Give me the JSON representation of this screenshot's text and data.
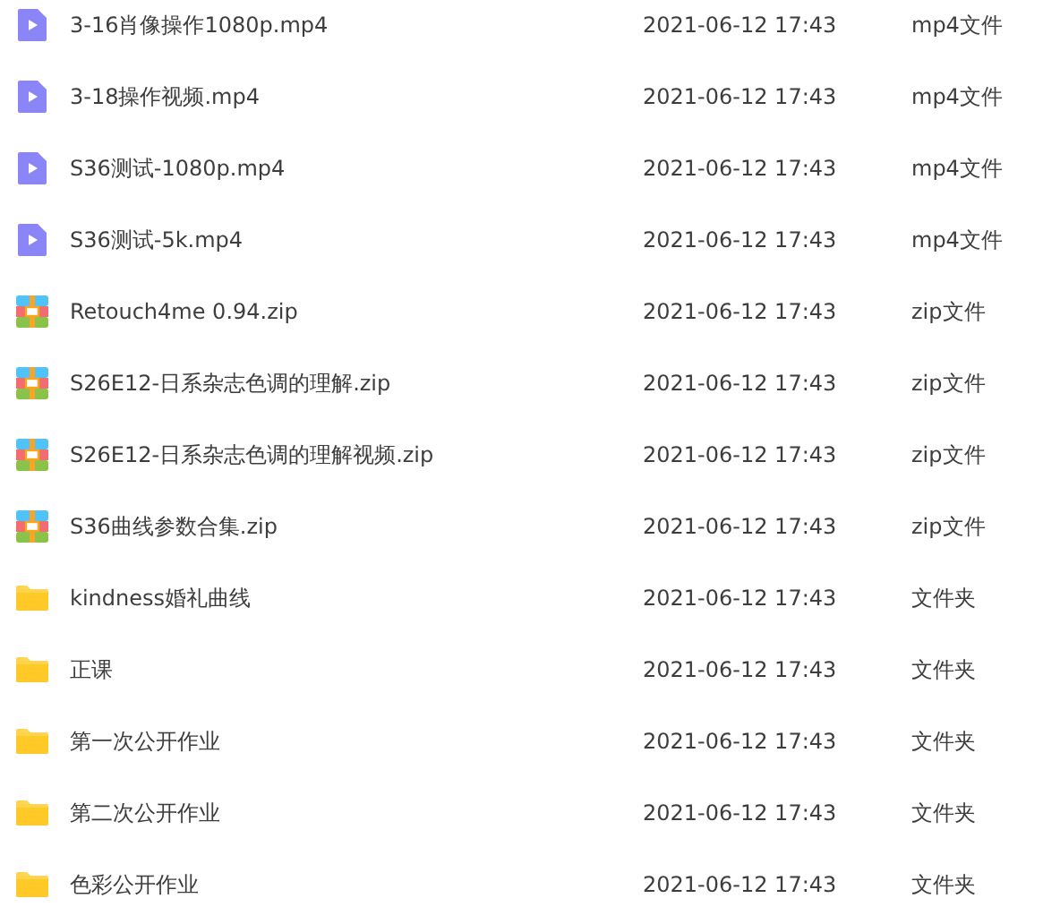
{
  "files": [
    {
      "kind": "video",
      "name": "3-16肖像操作1080p.mp4",
      "modified": "2021-06-12 17:43",
      "type": "mp4文件"
    },
    {
      "kind": "video",
      "name": "3-18操作视频.mp4",
      "modified": "2021-06-12 17:43",
      "type": "mp4文件"
    },
    {
      "kind": "video",
      "name": "S36测试-1080p.mp4",
      "modified": "2021-06-12 17:43",
      "type": "mp4文件"
    },
    {
      "kind": "video",
      "name": "S36测试-5k.mp4",
      "modified": "2021-06-12 17:43",
      "type": "mp4文件"
    },
    {
      "kind": "zip",
      "name": "Retouch4me 0.94.zip",
      "modified": "2021-06-12 17:43",
      "type": "zip文件"
    },
    {
      "kind": "zip",
      "name": "S26E12-日系杂志色调的理解.zip",
      "modified": "2021-06-12 17:43",
      "type": "zip文件"
    },
    {
      "kind": "zip",
      "name": "S26E12-日系杂志色调的理解视频.zip",
      "modified": "2021-06-12 17:43",
      "type": "zip文件"
    },
    {
      "kind": "zip",
      "name": "S36曲线参数合集.zip",
      "modified": "2021-06-12 17:43",
      "type": "zip文件"
    },
    {
      "kind": "folder",
      "name": "kindness婚礼曲线",
      "modified": "2021-06-12 17:43",
      "type": "文件夹"
    },
    {
      "kind": "folder",
      "name": "正课",
      "modified": "2021-06-12 17:43",
      "type": "文件夹"
    },
    {
      "kind": "folder",
      "name": "第一次公开作业",
      "modified": "2021-06-12 17:43",
      "type": "文件夹"
    },
    {
      "kind": "folder",
      "name": "第二次公开作业",
      "modified": "2021-06-12 17:43",
      "type": "文件夹"
    },
    {
      "kind": "folder",
      "name": "色彩公开作业",
      "modified": "2021-06-12 17:43",
      "type": "文件夹"
    }
  ]
}
